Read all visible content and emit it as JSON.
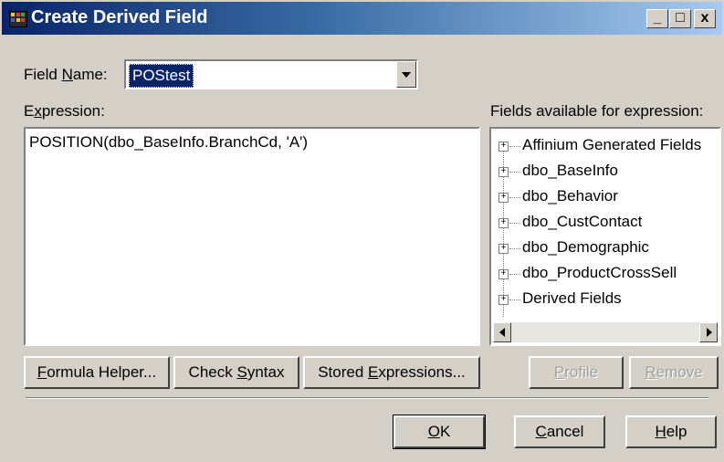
{
  "window": {
    "title": "Create Derived Field",
    "controls": {
      "minimize": "_",
      "maximize": "□",
      "close": "x"
    }
  },
  "field_name": {
    "label_before": "Field ",
    "label_accel": "N",
    "label_after": "ame:",
    "value": "POStest"
  },
  "expression": {
    "label_before": "E",
    "label_accel": "x",
    "label_after": "pression:",
    "value": "POSITION(dbo_BaseInfo.BranchCd, 'A')"
  },
  "fields_panel": {
    "label": "Fields available for expression:",
    "items": [
      "Affinium Generated Fields",
      "dbo_BaseInfo",
      "dbo_Behavior",
      "dbo_CustContact",
      "dbo_Demographic",
      "dbo_ProductCrossSell",
      "Derived Fields"
    ]
  },
  "buttons": {
    "formula_helper": {
      "accel": "F",
      "rest": "ormula Helper..."
    },
    "check_syntax": {
      "before": "Check ",
      "accel": "S",
      "rest": "yntax"
    },
    "stored_expressions": {
      "before": "Stored ",
      "accel": "E",
      "rest": "xpressions..."
    },
    "profile": {
      "accel": "P",
      "rest": "rofile"
    },
    "remove": {
      "accel": "R",
      "rest": "emove"
    },
    "ok": {
      "accel": "O",
      "rest": "K"
    },
    "cancel": {
      "accel": "C",
      "rest": "ancel"
    },
    "help": {
      "accel": "H",
      "rest": "elp"
    }
  },
  "colors": {
    "title_gradient_start": "#0a246a",
    "title_gradient_end": "#a6caf0",
    "dialog_face": "#d4d0c8",
    "selection": "#0a246a"
  }
}
